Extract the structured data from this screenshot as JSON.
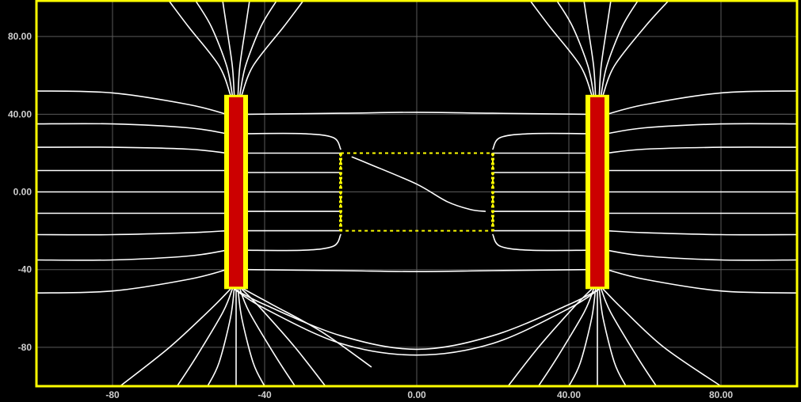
{
  "colors": {
    "background": "#000000",
    "frame": "#ffff00",
    "grid": "#5a5a5a",
    "field_lines": "#ffffff",
    "conductor_fill": "#cc0000",
    "conductor_edge": "#ffff00",
    "region_outline": "#ffff00",
    "tick_labels": "#cfcfcf"
  },
  "chart_data": {
    "type": "line",
    "title": "",
    "xlabel": "",
    "ylabel": "",
    "xlim": [
      -100,
      100
    ],
    "ylim": [
      -100,
      98
    ],
    "grid": true,
    "x_ticks": [
      {
        "value": -80,
        "label": "-80"
      },
      {
        "value": -40,
        "label": "-40"
      },
      {
        "value": 0,
        "label": "0.00"
      },
      {
        "value": 40,
        "label": "40.00"
      },
      {
        "value": 80,
        "label": "80.00"
      }
    ],
    "y_ticks": [
      {
        "value": 80,
        "label": "80.00"
      },
      {
        "value": 40,
        "label": "40.00"
      },
      {
        "value": 0,
        "label": "0.00"
      },
      {
        "value": -40,
        "label": "-40"
      },
      {
        "value": -80,
        "label": "-80"
      }
    ],
    "conductors": [
      {
        "x": [
          -50,
          -45
        ],
        "y": [
          -50,
          50
        ]
      },
      {
        "x": [
          45,
          50
        ],
        "y": [
          -50,
          50
        ]
      }
    ],
    "dashed_region": {
      "x": [
        -20,
        20
      ],
      "y": [
        -20,
        20
      ]
    },
    "field_lines": [
      {
        "x": [
          -100,
          -80,
          -60,
          -50
        ],
        "y": [
          52,
          51,
          45,
          40
        ]
      },
      {
        "x": [
          -100,
          -80,
          -60,
          -50
        ],
        "y": [
          35,
          35,
          33,
          30
        ]
      },
      {
        "x": [
          -100,
          -80,
          -60,
          -50
        ],
        "y": [
          23,
          23,
          22,
          20
        ]
      },
      {
        "x": [
          -100,
          -50
        ],
        "y": [
          11,
          11
        ]
      },
      {
        "x": [
          -100,
          -50
        ],
        "y": [
          0,
          0
        ]
      },
      {
        "x": [
          -100,
          -50
        ],
        "y": [
          -11,
          -11
        ]
      },
      {
        "x": [
          -100,
          -80,
          -60,
          -50
        ],
        "y": [
          -22,
          -22,
          -21,
          -20
        ]
      },
      {
        "x": [
          -100,
          -80,
          -60,
          -50
        ],
        "y": [
          -35,
          -35,
          -33,
          -30
        ]
      },
      {
        "x": [
          -100,
          -80,
          -60,
          -50
        ],
        "y": [
          -52,
          -51,
          -45,
          -40
        ]
      },
      {
        "x": [
          100,
          80,
          60,
          50
        ],
        "y": [
          52,
          51,
          45,
          40
        ]
      },
      {
        "x": [
          100,
          80,
          60,
          50
        ],
        "y": [
          35,
          35,
          33,
          30
        ]
      },
      {
        "x": [
          100,
          80,
          60,
          50
        ],
        "y": [
          23,
          23,
          22,
          20
        ]
      },
      {
        "x": [
          100,
          50
        ],
        "y": [
          11,
          11
        ]
      },
      {
        "x": [
          100,
          50
        ],
        "y": [
          0,
          0
        ]
      },
      {
        "x": [
          100,
          50
        ],
        "y": [
          -11,
          -11
        ]
      },
      {
        "x": [
          100,
          80,
          60,
          50
        ],
        "y": [
          -22,
          -22,
          -21,
          -20
        ]
      },
      {
        "x": [
          100,
          80,
          60,
          50
        ],
        "y": [
          -35,
          -35,
          -33,
          -30
        ]
      },
      {
        "x": [
          100,
          80,
          60,
          50
        ],
        "y": [
          -52,
          -51,
          -45,
          -40
        ]
      },
      {
        "x": [
          -45,
          -20,
          0,
          20,
          45
        ],
        "y": [
          40,
          40.5,
          41,
          40.5,
          40
        ]
      },
      {
        "x": [
          -45,
          -30,
          -22,
          -20
        ],
        "y": [
          30,
          30,
          28,
          22
        ]
      },
      {
        "x": [
          -45,
          -20
        ],
        "y": [
          20,
          20
        ]
      },
      {
        "x": [
          -45,
          -20
        ],
        "y": [
          10,
          10
        ]
      },
      {
        "x": [
          -45,
          -20
        ],
        "y": [
          0,
          0
        ]
      },
      {
        "x": [
          -45,
          -20
        ],
        "y": [
          -10,
          -10
        ]
      },
      {
        "x": [
          -45,
          -20
        ],
        "y": [
          -20,
          -20
        ]
      },
      {
        "x": [
          -45,
          -30,
          -22,
          -20
        ],
        "y": [
          -30,
          -30,
          -28,
          -22
        ]
      },
      {
        "x": [
          45,
          30,
          22,
          20
        ],
        "y": [
          30,
          30,
          28,
          22
        ]
      },
      {
        "x": [
          45,
          20
        ],
        "y": [
          20,
          20
        ]
      },
      {
        "x": [
          45,
          20
        ],
        "y": [
          10,
          10
        ]
      },
      {
        "x": [
          45,
          20
        ],
        "y": [
          0,
          0
        ]
      },
      {
        "x": [
          45,
          20
        ],
        "y": [
          -10,
          -10
        ]
      },
      {
        "x": [
          45,
          20
        ],
        "y": [
          -20,
          -20
        ]
      },
      {
        "x": [
          45,
          30,
          22,
          20
        ],
        "y": [
          -30,
          -30,
          -28,
          -22
        ]
      },
      {
        "x": [
          -45,
          -20,
          0,
          20,
          45
        ],
        "y": [
          -40,
          -40.5,
          -41,
          -40.5,
          -40
        ]
      },
      {
        "x": [
          -17,
          -12,
          0,
          8,
          14,
          18
        ],
        "y": [
          18,
          14,
          4,
          -5,
          -9,
          -10
        ]
      },
      {
        "x": [
          -48,
          -40,
          -20,
          0,
          20,
          40,
          48
        ],
        "y": [
          -50,
          -58,
          -74,
          -81,
          -74,
          -58,
          -50
        ]
      },
      {
        "x": [
          -48,
          -40,
          -20,
          0,
          20,
          40,
          48
        ],
        "y": [
          -50,
          -60,
          -78,
          -84,
          -78,
          -60,
          -50
        ]
      },
      {
        "x": [
          -49,
          -54,
          -65,
          -78
        ],
        "y": [
          -50,
          -60,
          -80,
          -100
        ]
      },
      {
        "x": [
          -48.5,
          -51,
          -58,
          -63
        ],
        "y": [
          -50,
          -62,
          -85,
          -100
        ]
      },
      {
        "x": [
          -48,
          -49,
          -52,
          -55
        ],
        "y": [
          -50,
          -65,
          -88,
          -100
        ]
      },
      {
        "x": [
          -47.5,
          -47.5,
          -47.5
        ],
        "y": [
          -50,
          -75,
          -100
        ]
      },
      {
        "x": [
          -47,
          -46,
          -43,
          -40
        ],
        "y": [
          -50,
          -65,
          -88,
          -100
        ]
      },
      {
        "x": [
          -46.5,
          -44,
          -37,
          -32
        ],
        "y": [
          -50,
          -62,
          -85,
          -100
        ]
      },
      {
        "x": [
          -46,
          -41,
          -32,
          -24
        ],
        "y": [
          -50,
          -60,
          -80,
          -100
        ]
      },
      {
        "x": [
          -45.5,
          -38,
          -25,
          -12
        ],
        "y": [
          -50,
          -58,
          -72,
          -90
        ]
      },
      {
        "x": [
          -49,
          -52,
          -60,
          -65
        ],
        "y": [
          50,
          65,
          85,
          98
        ]
      },
      {
        "x": [
          -48.5,
          -50,
          -54,
          -58
        ],
        "y": [
          50,
          65,
          85,
          98
        ]
      },
      {
        "x": [
          -48,
          -48.5,
          -50,
          -51
        ],
        "y": [
          50,
          65,
          85,
          98
        ]
      },
      {
        "x": [
          -47,
          -46.5,
          -45,
          -44
        ],
        "y": [
          50,
          65,
          85,
          98
        ]
      },
      {
        "x": [
          -46.5,
          -45,
          -41,
          -37
        ],
        "y": [
          50,
          65,
          85,
          98
        ]
      },
      {
        "x": [
          -46,
          -43,
          -35,
          -30
        ],
        "y": [
          50,
          65,
          85,
          98
        ]
      },
      {
        "x": [
          49,
          54,
          65,
          80
        ],
        "y": [
          -50,
          -60,
          -80,
          -100
        ]
      },
      {
        "x": [
          48.5,
          51,
          58,
          63
        ],
        "y": [
          -50,
          -62,
          -85,
          -100
        ]
      },
      {
        "x": [
          48,
          49,
          52,
          55
        ],
        "y": [
          -50,
          -65,
          -88,
          -100
        ]
      },
      {
        "x": [
          47.5,
          47.5,
          47.5
        ],
        "y": [
          -50,
          -75,
          -100
        ]
      },
      {
        "x": [
          47,
          46,
          43,
          40
        ],
        "y": [
          -50,
          -65,
          -88,
          -100
        ]
      },
      {
        "x": [
          46.5,
          44,
          37,
          32
        ],
        "y": [
          -50,
          -62,
          -85,
          -100
        ]
      },
      {
        "x": [
          46,
          41,
          32,
          24
        ],
        "y": [
          -50,
          -60,
          -80,
          -100
        ]
      },
      {
        "x": [
          49,
          52,
          60,
          66
        ],
        "y": [
          50,
          65,
          85,
          98
        ]
      },
      {
        "x": [
          48.5,
          50,
          54,
          58
        ],
        "y": [
          50,
          65,
          85,
          98
        ]
      },
      {
        "x": [
          48,
          48.5,
          50,
          51
        ],
        "y": [
          50,
          65,
          85,
          98
        ]
      },
      {
        "x": [
          47,
          46.5,
          45,
          44
        ],
        "y": [
          50,
          65,
          85,
          98
        ]
      },
      {
        "x": [
          46.5,
          45,
          41,
          37
        ],
        "y": [
          50,
          65,
          85,
          98
        ]
      },
      {
        "x": [
          46,
          43,
          35,
          30
        ],
        "y": [
          50,
          65,
          85,
          98
        ]
      }
    ]
  }
}
